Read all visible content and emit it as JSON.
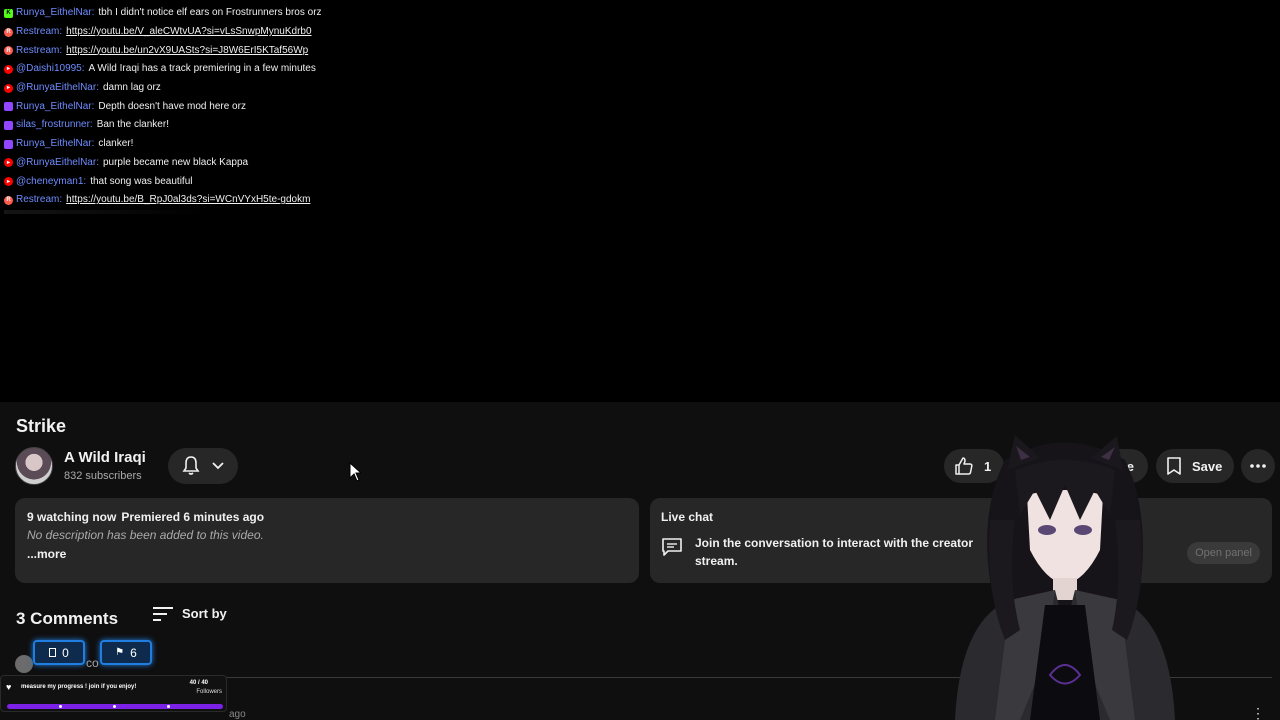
{
  "chat": {
    "lines": [
      {
        "platform": "kick",
        "user": "Runya_EithelNar",
        "message": "tbh I didn't notice elf ears on Frostrunners bros orz",
        "link": false
      },
      {
        "platform": "restream",
        "user": "Restream",
        "message": "https://youtu.be/V_aleCWtvUA?si=vLsSnwpMynuKdrb0",
        "link": true
      },
      {
        "platform": "restream",
        "user": "Restream",
        "message": "https://youtu.be/un2vX9UASts?si=J8W6ErI5KTaf56Wp",
        "link": true
      },
      {
        "platform": "youtube",
        "user": "@Daishi10995",
        "message": "A Wild Iraqi has a track premiering in a few minutes",
        "link": false
      },
      {
        "platform": "youtube",
        "user": "@RunyaEithelNar",
        "message": "damn lag orz",
        "link": false
      },
      {
        "platform": "twitch",
        "user": "Runya_EithelNar",
        "message": "Depth doesn't have mod here orz",
        "link": false
      },
      {
        "platform": "twitch",
        "user": "silas_frostrunner",
        "message": "Ban the clanker!",
        "link": false
      },
      {
        "platform": "twitch",
        "user": "Runya_EithelNar",
        "message": "clanker!",
        "link": false
      },
      {
        "platform": "youtube",
        "user": "@RunyaEithelNar",
        "message": "purple became new black Kappa",
        "link": false
      },
      {
        "platform": "youtube",
        "user": "@cheneyman1",
        "message": "that song was beautiful",
        "link": false
      },
      {
        "platform": "restream",
        "user": "Restream",
        "message": "https://youtu.be/B_RpJ0al3ds?si=WCnVYxH5te-gdokm",
        "link": true
      }
    ],
    "separator": ":"
  },
  "video": {
    "title": "Strike",
    "channel_name": "A Wild Iraqi",
    "subscribers": "832 subscribers",
    "like_count": "1",
    "share_label": "Share",
    "save_label": "Save"
  },
  "description": {
    "watching": "9 watching now",
    "premiered": "Premiered 6 minutes ago",
    "text": "No description has been added to this video.",
    "more_label": "...more"
  },
  "live_chat": {
    "title": "Live chat",
    "text_part1": "Join the conversation to interact with the creator",
    "text_part2": "live",
    "text_part3": "stream.",
    "open_panel_label": "Open panel"
  },
  "comments": {
    "count_label": "3 Comments",
    "sort_label": "Sort by",
    "partial_text": "co",
    "partial_time": "ago"
  },
  "stream_overlay": {
    "like_counter": "0",
    "save_counter": "6",
    "goal_text": "measure my progress ! join if you enjoy!",
    "goal_count": "40 / 40",
    "goal_label": "Followers"
  },
  "colors": {
    "background": "#0f0f0f",
    "pill": "#272727",
    "chat_username": "#6f8cff",
    "goal_bar": "#7b22e6",
    "counter_border": "#1f7ee0"
  }
}
